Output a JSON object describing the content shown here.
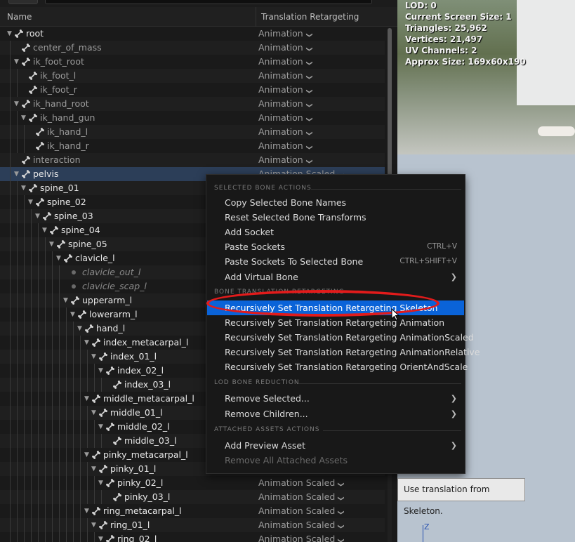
{
  "tree": {
    "columns": {
      "name": "Name",
      "retargeting": "Translation Retargeting"
    },
    "rows": [
      {
        "label": "root",
        "depth": 0,
        "expander": true,
        "retarget": "Animation",
        "style": "white",
        "icon": "bone"
      },
      {
        "label": "center_of_mass",
        "depth": 1,
        "expander": false,
        "retarget": "Animation",
        "style": "dim",
        "icon": "bone"
      },
      {
        "label": "ik_foot_root",
        "depth": 1,
        "expander": true,
        "retarget": "Animation",
        "style": "dim",
        "icon": "bone"
      },
      {
        "label": "ik_foot_l",
        "depth": 2,
        "expander": false,
        "retarget": "Animation",
        "style": "dim",
        "icon": "bone"
      },
      {
        "label": "ik_foot_r",
        "depth": 2,
        "expander": false,
        "retarget": "Animation",
        "style": "dim",
        "icon": "bone"
      },
      {
        "label": "ik_hand_root",
        "depth": 1,
        "expander": true,
        "retarget": "Animation",
        "style": "dim",
        "icon": "bone"
      },
      {
        "label": "ik_hand_gun",
        "depth": 2,
        "expander": true,
        "retarget": "Animation",
        "style": "dim",
        "icon": "bone"
      },
      {
        "label": "ik_hand_l",
        "depth": 3,
        "expander": false,
        "retarget": "Animation",
        "style": "dim",
        "icon": "bone"
      },
      {
        "label": "ik_hand_r",
        "depth": 3,
        "expander": false,
        "retarget": "Animation",
        "style": "dim",
        "icon": "bone"
      },
      {
        "label": "interaction",
        "depth": 1,
        "expander": false,
        "retarget": "Animation",
        "style": "dim",
        "icon": "bone"
      },
      {
        "label": "pelvis",
        "depth": 1,
        "expander": true,
        "retarget": "Animation Scaled",
        "style": "white",
        "icon": "bone",
        "selected": true
      },
      {
        "label": "spine_01",
        "depth": 2,
        "expander": true,
        "retarget": "",
        "style": "white",
        "icon": "bone"
      },
      {
        "label": "spine_02",
        "depth": 3,
        "expander": true,
        "retarget": "",
        "style": "white",
        "icon": "bone"
      },
      {
        "label": "spine_03",
        "depth": 4,
        "expander": true,
        "retarget": "",
        "style": "white",
        "icon": "bone"
      },
      {
        "label": "spine_04",
        "depth": 5,
        "expander": true,
        "retarget": "",
        "style": "white",
        "icon": "bone"
      },
      {
        "label": "spine_05",
        "depth": 6,
        "expander": true,
        "retarget": "",
        "style": "white",
        "icon": "bone"
      },
      {
        "label": "clavicle_l",
        "depth": 7,
        "expander": true,
        "retarget": "",
        "style": "white",
        "icon": "bone"
      },
      {
        "label": "clavicle_out_l",
        "depth": 8,
        "expander": false,
        "retarget": "",
        "style": "italic",
        "icon": "dot"
      },
      {
        "label": "clavicle_scap_l",
        "depth": 8,
        "expander": false,
        "retarget": "",
        "style": "italic",
        "icon": "dot"
      },
      {
        "label": "upperarm_l",
        "depth": 8,
        "expander": true,
        "retarget": "",
        "style": "white",
        "icon": "bone"
      },
      {
        "label": "lowerarm_l",
        "depth": 9,
        "expander": true,
        "retarget": "",
        "style": "white",
        "icon": "bone"
      },
      {
        "label": "hand_l",
        "depth": 10,
        "expander": true,
        "retarget": "",
        "style": "white",
        "icon": "bone"
      },
      {
        "label": "index_metacarpal_l",
        "depth": 11,
        "expander": true,
        "retarget": "",
        "style": "white",
        "icon": "bone"
      },
      {
        "label": "index_01_l",
        "depth": 12,
        "expander": true,
        "retarget": "",
        "style": "white",
        "icon": "bone"
      },
      {
        "label": "index_02_l",
        "depth": 13,
        "expander": true,
        "retarget": "",
        "style": "white",
        "icon": "bone"
      },
      {
        "label": "index_03_l",
        "depth": 14,
        "expander": false,
        "retarget": "",
        "style": "white",
        "icon": "bone"
      },
      {
        "label": "middle_metacarpal_l",
        "depth": 11,
        "expander": true,
        "retarget": "",
        "style": "white",
        "icon": "bone"
      },
      {
        "label": "middle_01_l",
        "depth": 12,
        "expander": true,
        "retarget": "",
        "style": "white",
        "icon": "bone"
      },
      {
        "label": "middle_02_l",
        "depth": 13,
        "expander": true,
        "retarget": "",
        "style": "white",
        "icon": "bone"
      },
      {
        "label": "middle_03_l",
        "depth": 14,
        "expander": false,
        "retarget": "",
        "style": "white",
        "icon": "bone"
      },
      {
        "label": "pinky_metacarpal_l",
        "depth": 11,
        "expander": true,
        "retarget": "",
        "style": "white",
        "icon": "bone"
      },
      {
        "label": "pinky_01_l",
        "depth": 12,
        "expander": true,
        "retarget": "",
        "style": "white",
        "icon": "bone"
      },
      {
        "label": "pinky_02_l",
        "depth": 13,
        "expander": true,
        "retarget": "Animation Scaled",
        "style": "white",
        "icon": "bone"
      },
      {
        "label": "pinky_03_l",
        "depth": 14,
        "expander": false,
        "retarget": "Animation Scaled",
        "style": "white",
        "icon": "bone"
      },
      {
        "label": "ring_metacarpal_l",
        "depth": 11,
        "expander": true,
        "retarget": "Animation Scaled",
        "style": "white",
        "icon": "bone"
      },
      {
        "label": "ring_01_l",
        "depth": 12,
        "expander": true,
        "retarget": "Animation Scaled",
        "style": "white",
        "icon": "bone"
      },
      {
        "label": "ring_02_l",
        "depth": 13,
        "expander": true,
        "retarget": "Animation Scaled",
        "style": "white",
        "icon": "bone"
      }
    ]
  },
  "viewport": {
    "stats": [
      "LOD: 0",
      "Current Screen Size: 1",
      "Triangles: 25,962",
      "Vertices: 21,497",
      "UV Channels: 2",
      "Approx Size: 169x60x190"
    ],
    "axis_label": "Z"
  },
  "menu": {
    "sections": {
      "selected": "SELECTED BONE ACTIONS",
      "translation": "BONE TRANSLATION RETARGETING",
      "lod": "LOD BONE REDUCTION",
      "attached": "ATTACHED ASSETS ACTIONS"
    },
    "items": {
      "copy_names": "Copy Selected Bone Names",
      "reset_transforms": "Reset Selected Bone Transforms",
      "add_socket": "Add Socket",
      "paste_sockets": "Paste Sockets",
      "paste_sockets_shortcut": "CTRL+V",
      "paste_to_bone": "Paste Sockets To Selected Bone",
      "paste_to_bone_shortcut": "CTRL+SHIFT+V",
      "add_virtual": "Add Virtual Bone",
      "retarget_skeleton": "Recursively Set Translation Retargeting Skeleton",
      "retarget_animation": "Recursively Set Translation Retargeting Animation",
      "retarget_anim_scaled": "Recursively Set Translation Retargeting AnimationScaled",
      "retarget_anim_relative": "Recursively Set Translation Retargeting AnimationRelative",
      "retarget_orient_scale": "Recursively Set Translation Retargeting OrientAndScale",
      "remove_selected": "Remove Selected...",
      "remove_children": "Remove Children...",
      "add_preview": "Add Preview Asset",
      "remove_attached": "Remove All Attached Assets"
    }
  },
  "tooltip": "Use translation from Skeleton.",
  "colors": {
    "highlight": "#0a63d8",
    "annotation_ring": "#e21b1b",
    "selected_row": "#2c3e58"
  }
}
